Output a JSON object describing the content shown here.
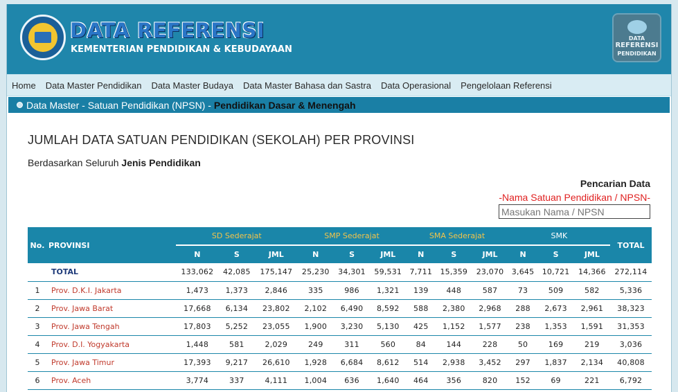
{
  "header": {
    "title": "DATA REFERENSI",
    "subtitle": "KEMENTERIAN PENDIDIKAN & KEBUDAYAAN",
    "badge_line1": "DATA",
    "badge_line2": "REFERENSI",
    "badge_line3": "PENDIDIKAN"
  },
  "nav": {
    "items": [
      "Home",
      "Data Master Pendidikan",
      "Data Master Budaya",
      "Data Master Bahasa dan Sastra",
      "Data Operasional",
      "Pengelolaan Referensi"
    ]
  },
  "breadcrumb": {
    "prefix": "Data Master - Satuan Pendidikan (NPSN) -",
    "current": "Pendidikan Dasar & Menengah"
  },
  "main": {
    "heading": "JUMLAH DATA SATUAN PENDIDIKAN (SEKOLAH) PER PROVINSI",
    "by_prefix": "Berdasarkan Seluruh",
    "by_bold": "Jenis Pendidikan"
  },
  "search": {
    "label": "Pencarian Data",
    "hint": "-Nama Satuan Pendidikan / NPSN-",
    "placeholder": "Masukan Nama / NPSN"
  },
  "table": {
    "col_no": "No.",
    "col_prov": "PROVINSI",
    "col_total": "TOTAL",
    "groups": [
      "SD Sederajat",
      "SMP Sederajat",
      "SMA Sederajat",
      "SMK"
    ],
    "sub": [
      "N",
      "S",
      "JML"
    ],
    "total_row": {
      "label": "TOTAL",
      "values": [
        "133,062",
        "42,085",
        "175,147",
        "25,230",
        "34,301",
        "59,531",
        "7,711",
        "15,359",
        "23,070",
        "3,645",
        "10,721",
        "14,366",
        "272,114"
      ]
    },
    "rows": [
      {
        "no": "1",
        "prov": "Prov. D.K.I. Jakarta",
        "values": [
          "1,473",
          "1,373",
          "2,846",
          "335",
          "986",
          "1,321",
          "139",
          "448",
          "587",
          "73",
          "509",
          "582",
          "5,336"
        ]
      },
      {
        "no": "2",
        "prov": "Prov. Jawa Barat",
        "values": [
          "17,668",
          "6,134",
          "23,802",
          "2,102",
          "6,490",
          "8,592",
          "588",
          "2,380",
          "2,968",
          "288",
          "2,673",
          "2,961",
          "38,323"
        ]
      },
      {
        "no": "3",
        "prov": "Prov. Jawa Tengah",
        "values": [
          "17,803",
          "5,252",
          "23,055",
          "1,900",
          "3,230",
          "5,130",
          "425",
          "1,152",
          "1,577",
          "238",
          "1,353",
          "1,591",
          "31,353"
        ]
      },
      {
        "no": "4",
        "prov": "Prov. D.I. Yogyakarta",
        "values": [
          "1,448",
          "581",
          "2,029",
          "249",
          "311",
          "560",
          "84",
          "144",
          "228",
          "50",
          "169",
          "219",
          "3,036"
        ]
      },
      {
        "no": "5",
        "prov": "Prov. Jawa Timur",
        "values": [
          "17,393",
          "9,217",
          "26,610",
          "1,928",
          "6,684",
          "8,612",
          "514",
          "2,938",
          "3,452",
          "297",
          "1,837",
          "2,134",
          "40,808"
        ]
      },
      {
        "no": "6",
        "prov": "Prov. Aceh",
        "values": [
          "3,774",
          "337",
          "4,111",
          "1,004",
          "636",
          "1,640",
          "464",
          "356",
          "820",
          "152",
          "69",
          "221",
          "6,792"
        ]
      }
    ]
  }
}
